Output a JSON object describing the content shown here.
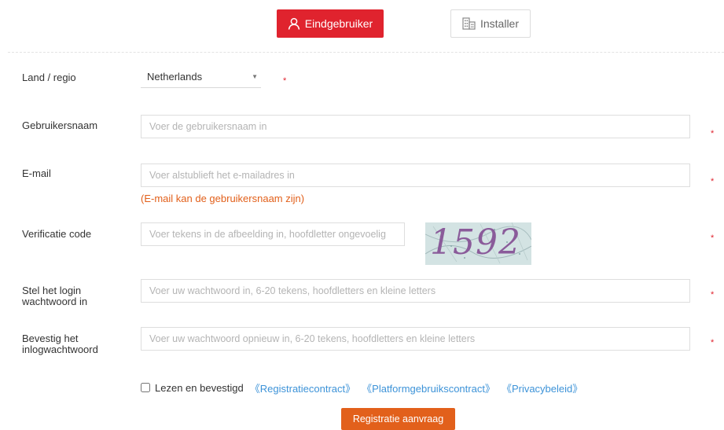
{
  "tabs": {
    "enduser": "Eindgebruiker",
    "installer": "Installer",
    "active": "enduser",
    "active_color": "#e0232e"
  },
  "form": {
    "country": {
      "label": "Land / regio",
      "value": "Netherlands",
      "required": "*"
    },
    "username": {
      "label": "Gebruikersnaam",
      "placeholder": "Voer de gebruikersnaam in",
      "required": "*"
    },
    "email": {
      "label": "E-mail",
      "placeholder": "Voer alstublieft het e-mailadres in",
      "hint": "(E-mail kan de gebruikersnaam zijn)",
      "required": "*"
    },
    "captcha": {
      "label": "Verificatie code",
      "placeholder": "Voer tekens in de afbeelding in, hoofdletter ongevoelig",
      "image_text": "1592",
      "required": "*"
    },
    "password": {
      "label_line1": "Stel het login",
      "label_line2": "wachtwoord in",
      "placeholder": "Voer uw wachtwoord in, 6-20 tekens, hoofdletters en kleine letters",
      "required": "*"
    },
    "confirm": {
      "label_line1": "Bevestig het",
      "label_line2": "inlogwachtwoord",
      "placeholder": "Voer uw wachtwoord opnieuw in, 6-20 tekens, hoofdletters en kleine letters",
      "required": "*"
    }
  },
  "agreement": {
    "text": "Lezen en bevestigd",
    "links": [
      "《Registratiecontract》",
      "《Platformgebruikscontract》",
      "《Privacybeleid》"
    ]
  },
  "submit": {
    "label": "Registratie aanvraag",
    "color": "#e2601b"
  },
  "icons": {
    "enduser_tab": "user-icon",
    "installer_tab": "building-icon"
  }
}
